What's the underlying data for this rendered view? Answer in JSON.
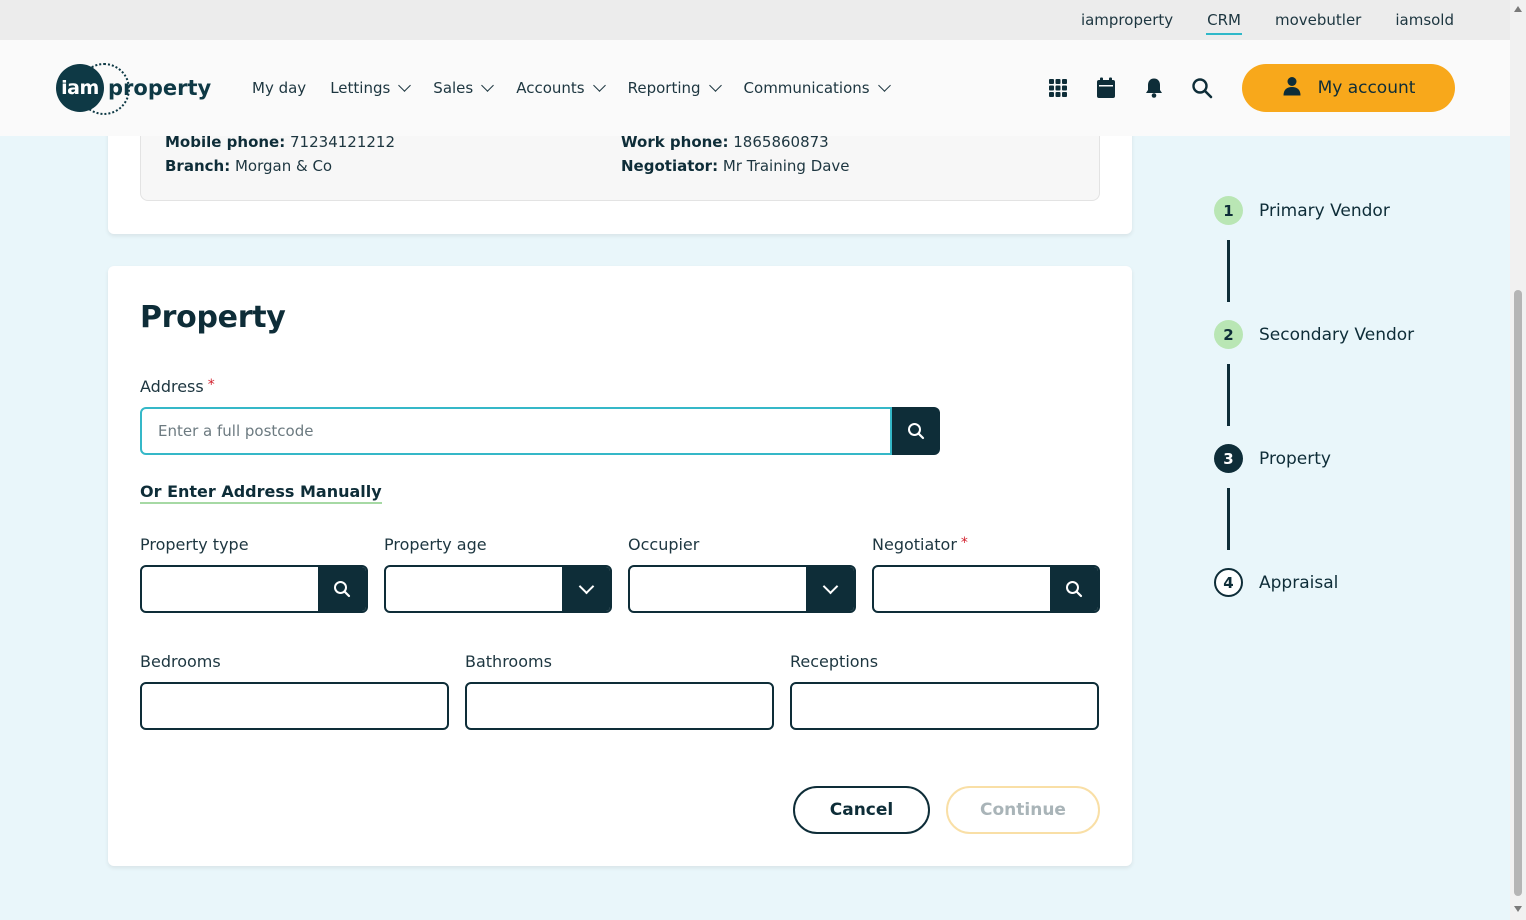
{
  "topbar": {
    "links": [
      "iamproperty",
      "CRM",
      "movebutler",
      "iamsold"
    ],
    "active": "CRM"
  },
  "header": {
    "logo_mark": "iam",
    "logo_word": "property",
    "nav": {
      "my_day": "My day",
      "lettings": "Lettings",
      "sales": "Sales",
      "accounts": "Accounts",
      "reporting": "Reporting",
      "communications": "Communications"
    },
    "icons": [
      "apps-grid-icon",
      "calendar-icon",
      "bell-icon",
      "search-icon"
    ],
    "account_label": "My account"
  },
  "contact_card": {
    "mobile_label": "Mobile phone:",
    "mobile_value": "71234121212",
    "branch_label": "Branch:",
    "branch_value": "Morgan & Co",
    "work_label": "Work phone:",
    "work_value": "1865860873",
    "negotiator_label": "Negotiator:",
    "negotiator_value": "Mr Training Dave"
  },
  "property_form": {
    "title": "Property",
    "address_label": "Address",
    "required_mark": "*",
    "address_placeholder": "Enter a full postcode",
    "address_value": "",
    "manual_link": "Or Enter Address Manually",
    "property_type_label": "Property type",
    "property_age_label": "Property age",
    "occupier_label": "Occupier",
    "negotiator_label": "Negotiator",
    "bedrooms_label": "Bedrooms",
    "bathrooms_label": "Bathrooms",
    "receptions_label": "Receptions",
    "cancel_label": "Cancel",
    "continue_label": "Continue"
  },
  "steps": [
    {
      "number": "1",
      "label": "Primary Vendor",
      "state": "done"
    },
    {
      "number": "2",
      "label": "Secondary Vendor",
      "state": "done"
    },
    {
      "number": "3",
      "label": "Property",
      "state": "current"
    },
    {
      "number": "4",
      "label": "Appraisal",
      "state": "todo"
    }
  ],
  "colors": {
    "brand_dark": "#0e2d38",
    "accent_orange": "#f8a81b",
    "focus_teal": "#35b8c8",
    "step_done_green": "#b9e6b4",
    "page_bg": "#e9f6fa"
  }
}
